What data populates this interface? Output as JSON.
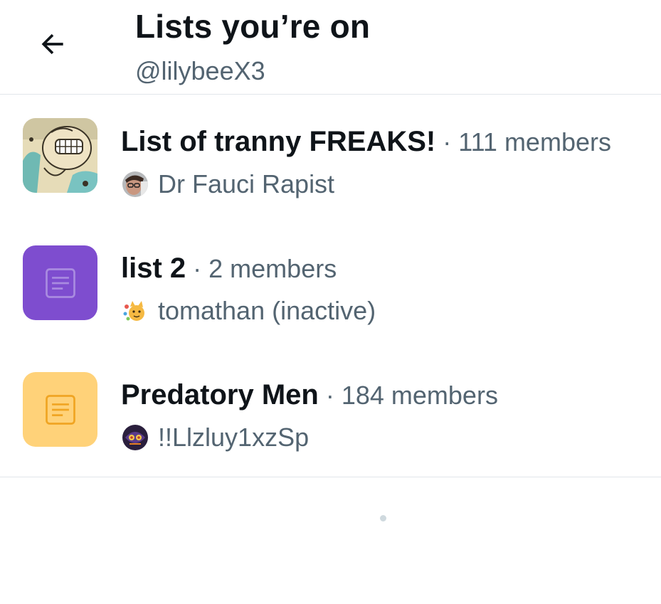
{
  "header": {
    "back_icon": "arrow-left-icon",
    "title": "Lists you’re on",
    "handle": "@lilybeeX3"
  },
  "lists": [
    {
      "name": "List of tranny FREAKS!",
      "members": "· 111 members",
      "owner": "Dr Fauci Rapist",
      "thumb": "comic-face-image",
      "owner_avatar": "man-with-glasses-avatar"
    },
    {
      "name": "list 2",
      "members": "· 2 members",
      "owner": "tomathan (inactive)",
      "thumb": "list-document-icon",
      "thumb_color": "#7e4dcf",
      "owner_avatar": "party-cat-avatar"
    },
    {
      "name": "Predatory Men",
      "members": "· 184 members",
      "owner": "!!Llzluy1xzSp",
      "thumb": "list-document-icon",
      "thumb_color": "#ffd279",
      "owner_avatar": "dark-mask-avatar"
    }
  ],
  "colors": {
    "text_primary": "#0f1419",
    "text_secondary": "#536471",
    "divider": "#e1e6ea"
  }
}
